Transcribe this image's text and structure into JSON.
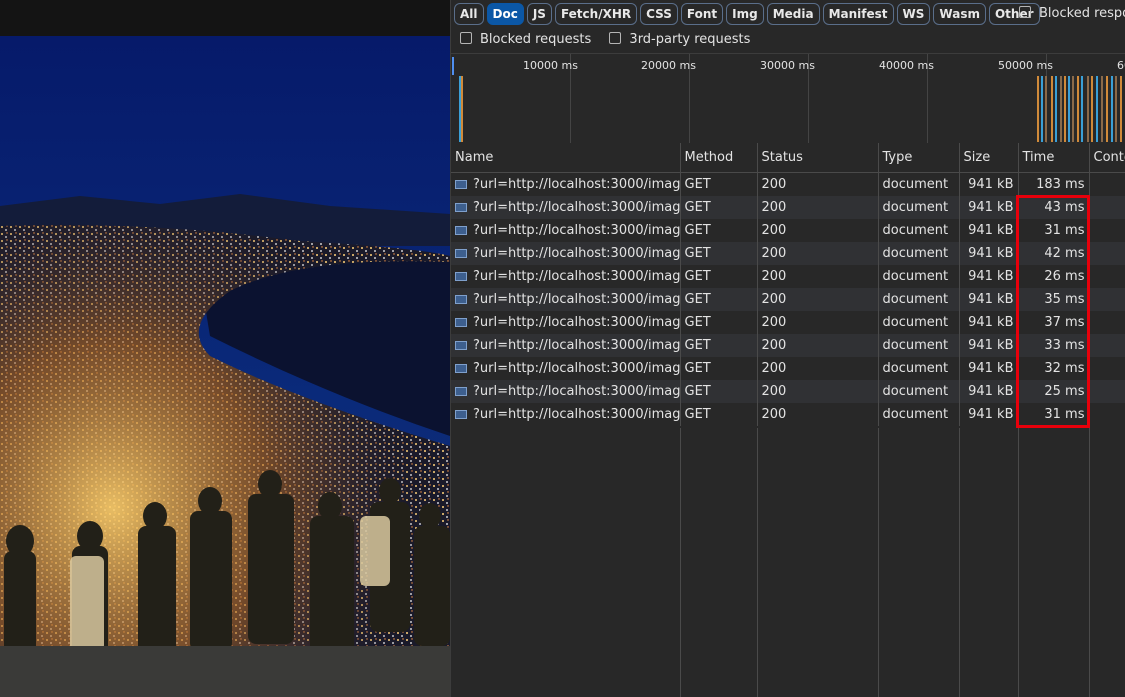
{
  "toolbar": {
    "filters": [
      {
        "label": "All",
        "active": false
      },
      {
        "label": "Doc",
        "active": true
      },
      {
        "label": "JS",
        "active": false
      },
      {
        "label": "Fetch/XHR",
        "active": false
      },
      {
        "label": "CSS",
        "active": false
      },
      {
        "label": "Font",
        "active": false
      },
      {
        "label": "Img",
        "active": false
      },
      {
        "label": "Media",
        "active": false
      },
      {
        "label": "Manifest",
        "active": false
      },
      {
        "label": "WS",
        "active": false
      },
      {
        "label": "Wasm",
        "active": false
      },
      {
        "label": "Other",
        "active": false
      }
    ],
    "blocked_responses": "Blocked respor",
    "blocked_requests": "Blocked requests",
    "third_party": "3rd-party requests"
  },
  "overview": {
    "ticks": [
      "10000 ms",
      "20000 ms",
      "30000 ms",
      "40000 ms",
      "50000 ms",
      "60"
    ]
  },
  "columns": {
    "name": "Name",
    "method": "Method",
    "status": "Status",
    "type": "Type",
    "size": "Size",
    "time": "Time",
    "content": "Conte"
  },
  "rows": [
    {
      "name": "?url=http://localhost:3000/imag...",
      "method": "GET",
      "status": "200",
      "type": "document",
      "size": "941 kB",
      "time": "183 ms"
    },
    {
      "name": "?url=http://localhost:3000/imag...",
      "method": "GET",
      "status": "200",
      "type": "document",
      "size": "941 kB",
      "time": "43 ms"
    },
    {
      "name": "?url=http://localhost:3000/imag...",
      "method": "GET",
      "status": "200",
      "type": "document",
      "size": "941 kB",
      "time": "31 ms"
    },
    {
      "name": "?url=http://localhost:3000/imag...",
      "method": "GET",
      "status": "200",
      "type": "document",
      "size": "941 kB",
      "time": "42 ms"
    },
    {
      "name": "?url=http://localhost:3000/imag...",
      "method": "GET",
      "status": "200",
      "type": "document",
      "size": "941 kB",
      "time": "26 ms"
    },
    {
      "name": "?url=http://localhost:3000/imag...",
      "method": "GET",
      "status": "200",
      "type": "document",
      "size": "941 kB",
      "time": "35 ms"
    },
    {
      "name": "?url=http://localhost:3000/imag...",
      "method": "GET",
      "status": "200",
      "type": "document",
      "size": "941 kB",
      "time": "37 ms"
    },
    {
      "name": "?url=http://localhost:3000/imag...",
      "method": "GET",
      "status": "200",
      "type": "document",
      "size": "941 kB",
      "time": "33 ms"
    },
    {
      "name": "?url=http://localhost:3000/imag...",
      "method": "GET",
      "status": "200",
      "type": "document",
      "size": "941 kB",
      "time": "32 ms"
    },
    {
      "name": "?url=http://localhost:3000/imag...",
      "method": "GET",
      "status": "200",
      "type": "document",
      "size": "941 kB",
      "time": "25 ms"
    },
    {
      "name": "?url=http://localhost:3000/imag...",
      "method": "GET",
      "status": "200",
      "type": "document",
      "size": "941 kB",
      "time": "31 ms"
    }
  ],
  "colors": {
    "active_filter": "#0b57a6",
    "highlight": "#e8000b",
    "panel_bg": "#282828"
  }
}
